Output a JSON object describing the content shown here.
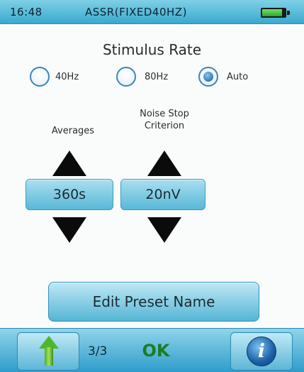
{
  "status_bar": {
    "time": "16:48",
    "mode": "ASSR(FIXED40HZ)",
    "battery_icon": "battery-icon"
  },
  "stimulus_rate": {
    "title": "Stimulus Rate",
    "options": [
      {
        "label": "40Hz",
        "selected": false
      },
      {
        "label": "80Hz",
        "selected": false
      },
      {
        "label": "Auto",
        "selected": true
      }
    ]
  },
  "averages": {
    "label": "Averages",
    "value": "360s",
    "up_icon": "arrow-up-icon",
    "down_icon": "arrow-down-icon"
  },
  "noise_stop": {
    "label_line1": "Noise Stop",
    "label_line2": "Criterion",
    "value": "20nV",
    "up_icon": "arrow-up-icon",
    "down_icon": "arrow-down-icon"
  },
  "edit_button_label": "Edit Preset Name",
  "bottom_bar": {
    "up_icon": "green-up-arrow-icon",
    "page_indicator": "3/3",
    "ok_label": "OK",
    "info_label": "i"
  },
  "colors": {
    "accent": "#3aa9cf",
    "button": "#5ab8d7",
    "ok_text": "#1a7d22",
    "radio_selected": "#125a9b"
  }
}
